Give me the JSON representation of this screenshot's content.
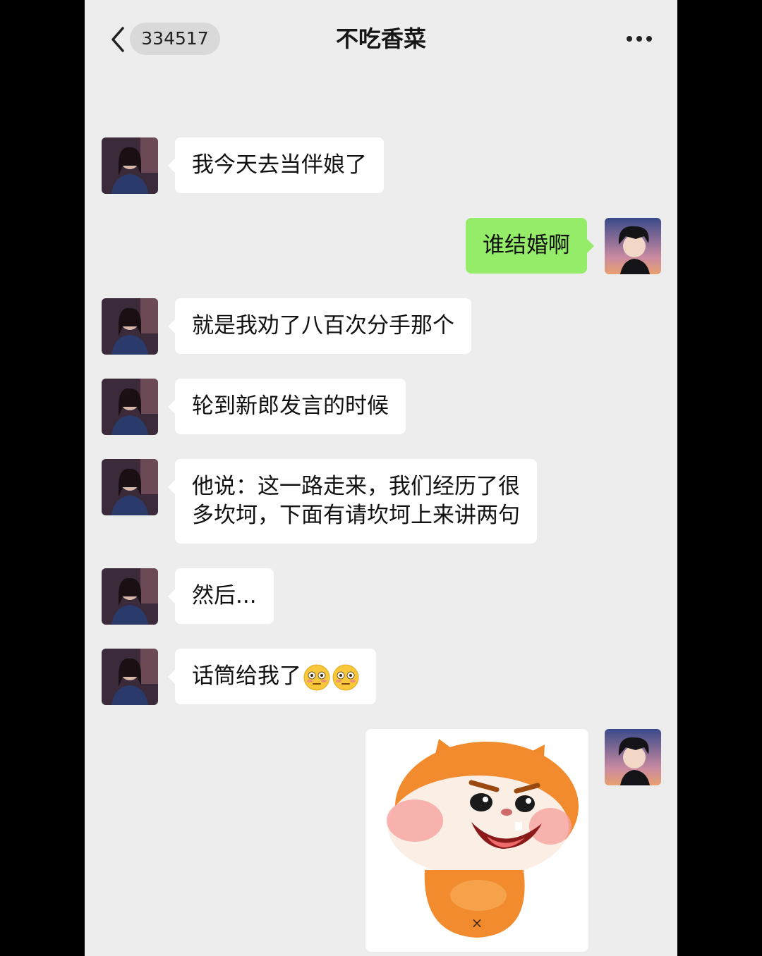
{
  "header": {
    "unread_count": "334517",
    "chat_title": "不吃香菜"
  },
  "messages": [
    {
      "side": "in",
      "text": "我今天去当伴娘了"
    },
    {
      "side": "out",
      "text": "谁结婚啊"
    },
    {
      "side": "in",
      "text": "就是我劝了八百次分手那个"
    },
    {
      "side": "in",
      "text": "轮到新郎发言的时候"
    },
    {
      "side": "in",
      "lines": [
        "他说：这一路走来，我们经历了很",
        "多坎坷，下面有请坎坷上来讲两句"
      ]
    },
    {
      "side": "in",
      "text": "然后..."
    },
    {
      "side": "in",
      "text": "话筒给我了",
      "emojis": [
        "flushed-face-emoji",
        "flushed-face-emoji"
      ]
    },
    {
      "side": "out",
      "type": "sticker",
      "sticker": "laughing-hamster-sticker"
    }
  ],
  "colors": {
    "chat_background": "#ededed",
    "outgoing_bubble": "#95ec69",
    "incoming_bubble": "#ffffff"
  }
}
